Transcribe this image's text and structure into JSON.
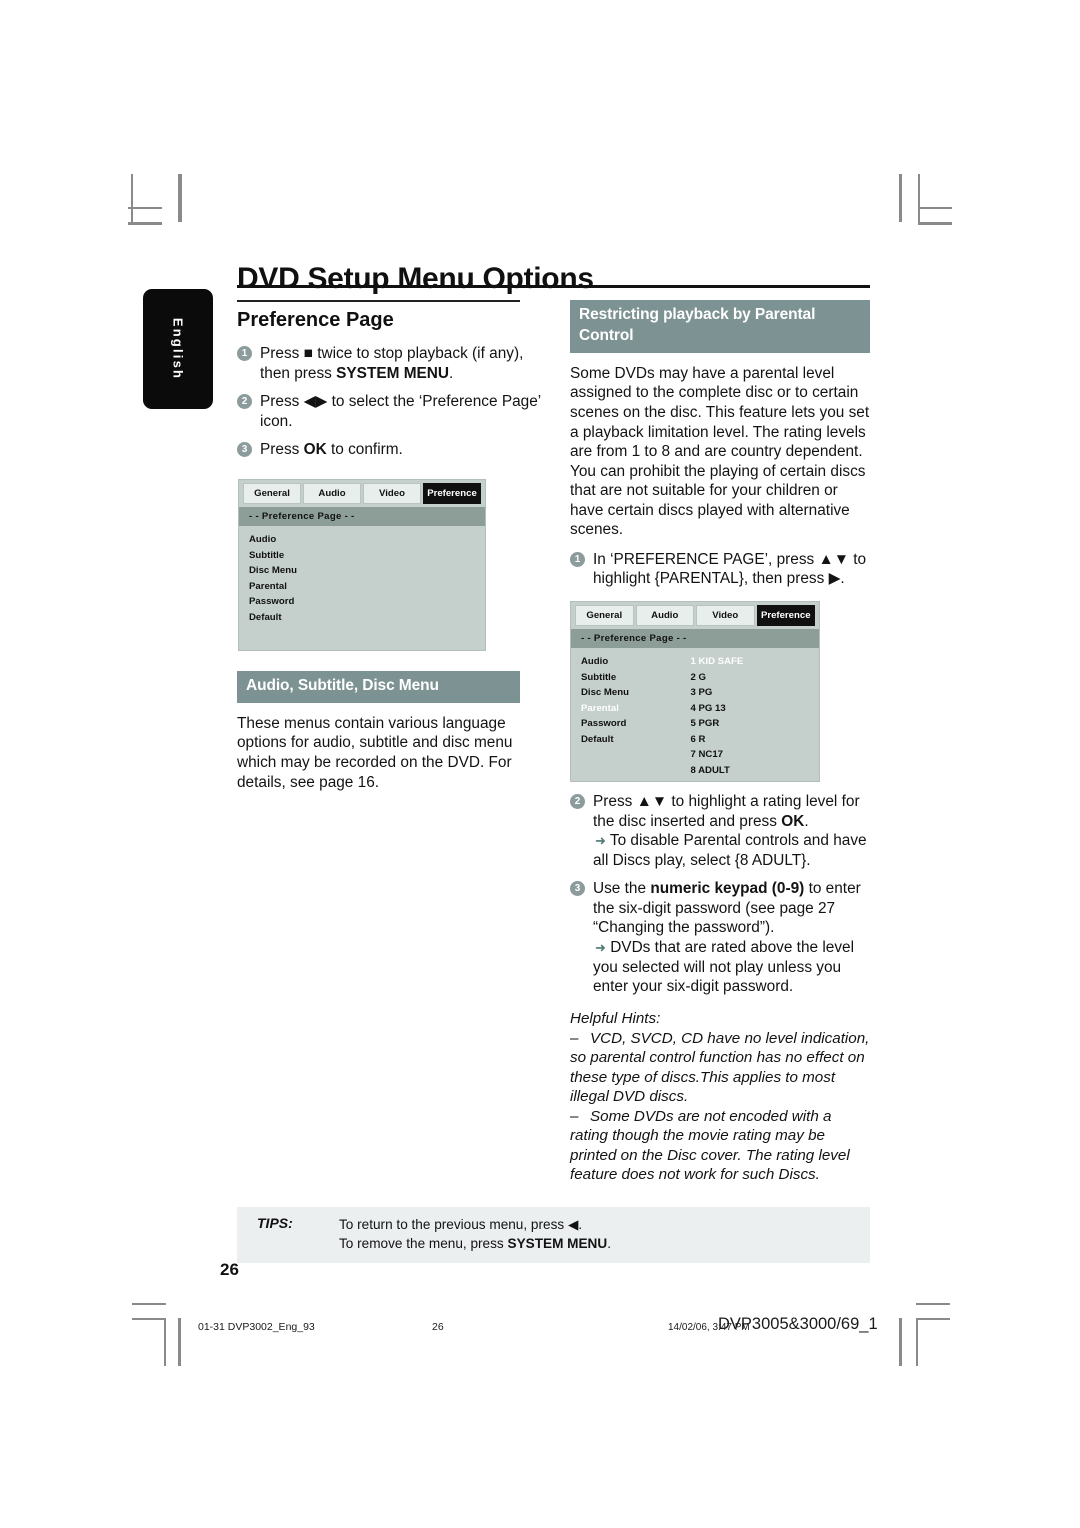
{
  "sidebar": {
    "language_tab": "English"
  },
  "header": {
    "title": "DVD Setup Menu Options"
  },
  "colors": {
    "band": "#7d9292",
    "osd_bg": "#c5d0cc",
    "osd_subhead": "#8d9e99",
    "step_bullet": "#8c9c9c",
    "tips_bg": "#eceff0"
  },
  "left_column": {
    "section_title": "Preference Page",
    "steps": [
      {
        "num": "1",
        "parts": [
          {
            "text": "Press "
          },
          {
            "text": "■",
            "style": "glyph"
          },
          {
            "text": " twice to stop playback (if any), then press "
          },
          {
            "text": "SYSTEM MENU",
            "style": "bold"
          },
          {
            "text": "."
          }
        ]
      },
      {
        "num": "2",
        "parts": [
          {
            "text": "Press "
          },
          {
            "text": "◀▶",
            "style": "glyph"
          },
          {
            "text": " to select the ‘Preference Page’ icon."
          }
        ]
      },
      {
        "num": "3",
        "parts": [
          {
            "text": "Press "
          },
          {
            "text": "OK",
            "style": "bold"
          },
          {
            "text": " to confirm."
          }
        ]
      }
    ],
    "audio_section": {
      "heading": "Audio, Subtitle, Disc Menu",
      "body": "These menus contain various language options for audio, subtitle and disc menu which may be recorded on the DVD.  For details, see page 16."
    }
  },
  "right_column": {
    "section_heading": "Restricting playback by Parental Control",
    "intro": "Some DVDs may have a parental level assigned to the complete disc or to certain scenes on the disc. This feature lets you set a playback limitation level. The rating levels are from 1 to 8 and are country dependent. You can prohibit the playing of certain discs that are not suitable for your children or have certain discs played with alternative scenes.",
    "steps": [
      {
        "num": "1",
        "parts": [
          {
            "text": "In ‘PREFERENCE PAGE’, press "
          },
          {
            "text": "▲▼",
            "style": "glyph"
          },
          {
            "text": " to highlight {PARENTAL}, then press "
          },
          {
            "text": "▶",
            "style": "glyph"
          },
          {
            "text": "."
          }
        ]
      },
      {
        "num": "2",
        "parts": [
          {
            "text": "Press "
          },
          {
            "text": "▲▼",
            "style": "glyph"
          },
          {
            "text": " to highlight a rating level for the disc inserted and press "
          },
          {
            "text": "OK",
            "style": "bold"
          },
          {
            "text": "."
          }
        ],
        "arrow_note": "To disable Parental controls and have all Discs play, select {8 ADULT}."
      },
      {
        "num": "3",
        "parts": [
          {
            "text": "Use the "
          },
          {
            "text": "numeric keypad (0-9)",
            "style": "bold"
          },
          {
            "text": " to enter the six-digit password (see page 27 “Changing the password”)."
          }
        ],
        "arrow_note": "DVDs that are rated above the level you selected will not play unless you enter your six-digit password."
      }
    ],
    "hints": {
      "title": "Helpful Hints:",
      "items": [
        "VCD, SVCD, CD have no level indication, so parental control function has no effect on these type of discs.This applies to most illegal DVD discs.",
        "Some DVDs are not encoded with a rating though the movie rating may be printed on the Disc cover. The rating level feature does not work for such Discs."
      ]
    }
  },
  "osd_menu_1": {
    "tabs": [
      "General",
      "Audio",
      "Video",
      "Preference"
    ],
    "active_tab": "Preference",
    "subhead": "- -  Preference Page   - -",
    "items": [
      "Audio",
      "Subtitle",
      "Disc Menu",
      "Parental",
      "Password",
      "Default"
    ],
    "selected_item": "",
    "values": []
  },
  "osd_menu_2": {
    "tabs": [
      "General",
      "Audio",
      "Video",
      "Preference"
    ],
    "active_tab": "Preference",
    "subhead": "- -  Preference Page   - -",
    "items": [
      "Audio",
      "Subtitle",
      "Disc Menu",
      "Parental",
      "Password",
      "Default"
    ],
    "selected_item": "Parental",
    "values": [
      "1 KID SAFE",
      "2 G",
      "3 PG",
      "4 PG 13",
      "5 PGR",
      "6 R",
      "7 NC17",
      "8 ADULT"
    ],
    "selected_value": "1 KID SAFE"
  },
  "tips": {
    "label": "TIPS:",
    "line1_prefix": "To return to the previous menu, press ",
    "line1_glyph": "◀",
    "line1_suffix": ".",
    "line2_prefix": "To remove the menu, press ",
    "line2_bold": "SYSTEM MENU",
    "line2_suffix": "."
  },
  "page_number": "26",
  "footer": {
    "file": "01-31 DVP3002_Eng_93",
    "page": "26",
    "date": "14/02/06, 3:47 PM",
    "model": "DVP3005&3000/69_1"
  }
}
